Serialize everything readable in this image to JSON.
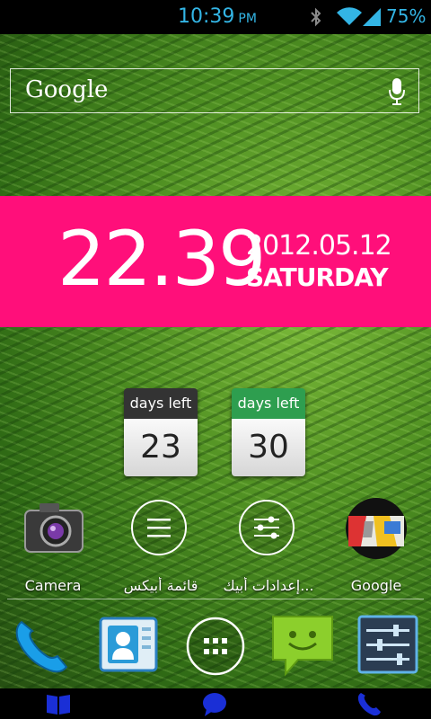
{
  "status_bar": {
    "time": "10:39",
    "ampm": "PM",
    "battery": "75%",
    "icons": [
      "bluetooth-icon",
      "wifi-icon",
      "signal-icon"
    ],
    "color": "#33b5e5"
  },
  "search_widget": {
    "logo_text": "Google",
    "icon": "mic-icon"
  },
  "clock_widget": {
    "time": "22.39",
    "date": "2012.05.12",
    "day": "SATURDAY",
    "background": "#ff0f7a"
  },
  "countdown_widgets": [
    {
      "header": "days left",
      "value": "23",
      "header_color": "#333333"
    },
    {
      "header": "days left",
      "value": "30",
      "header_color": "#2e9e4f"
    }
  ],
  "apps": [
    {
      "label": "Camera",
      "icon": "camera-icon"
    },
    {
      "label": "قائمة أبيكس",
      "icon": "menu-icon"
    },
    {
      "label": "إعدادات أبيك...",
      "icon": "settings-sliders-icon"
    },
    {
      "label": "Google",
      "icon": "google-maps-icon"
    }
  ],
  "dock": [
    {
      "icon": "phone-icon"
    },
    {
      "icon": "contacts-icon"
    },
    {
      "icon": "app-drawer-icon"
    },
    {
      "icon": "messaging-icon"
    },
    {
      "icon": "settings-icon"
    }
  ],
  "bottom_bar": {
    "icons": [
      "book-icon",
      "chat-icon",
      "phone-icon"
    ],
    "color": "#1a2fd6"
  }
}
